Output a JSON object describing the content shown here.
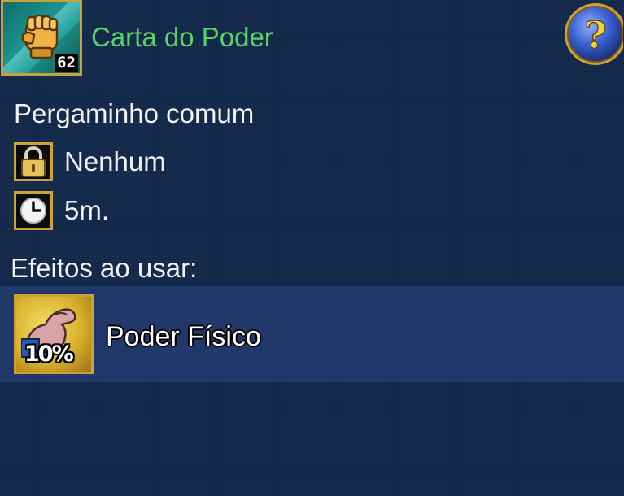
{
  "item": {
    "name": "Carta do Poder",
    "level": "62",
    "icon": "fist-card-icon",
    "name_color": "#58d36a"
  },
  "help": {
    "label": "?",
    "icon": "help-question-icon"
  },
  "details": {
    "type": "Pergaminho comum",
    "binding": "Nenhum",
    "binding_icon": "lock-icon",
    "duration": "5m.",
    "duration_icon": "clock-icon"
  },
  "effects": {
    "heading": "Efeitos ao usar:",
    "items": [
      {
        "name": "Poder Físico",
        "percent": "10%",
        "icon": "flexed-arm-icon"
      }
    ]
  },
  "colors": {
    "background": "#13294a",
    "highlight_row": "#22386a",
    "frame_gold": "#c9a23a"
  }
}
